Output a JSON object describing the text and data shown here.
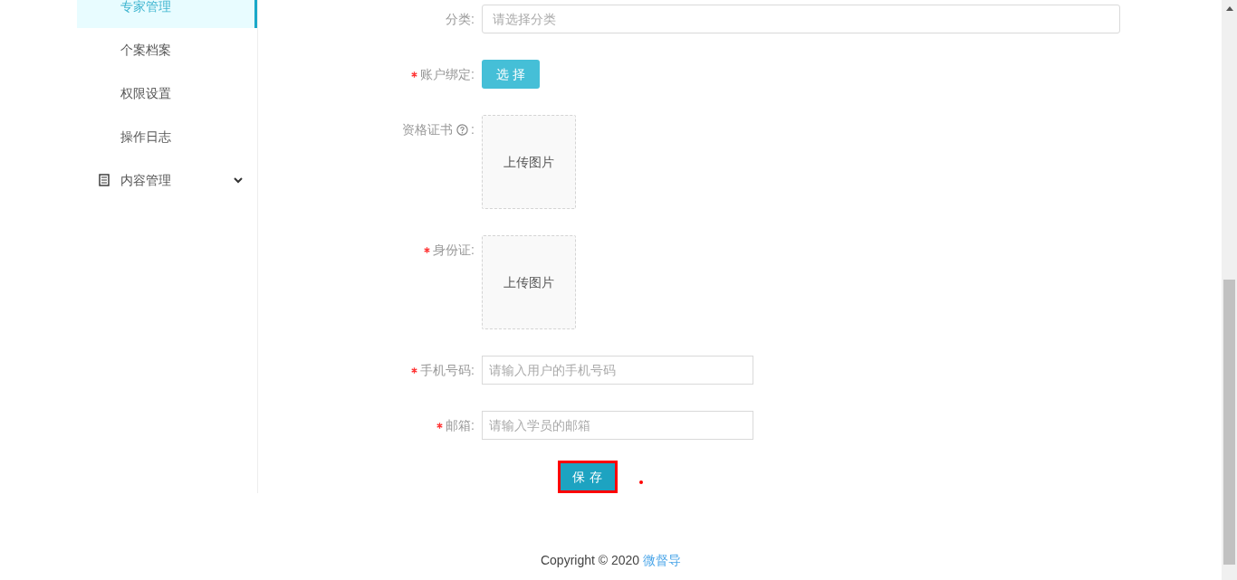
{
  "sidebar": {
    "items": [
      {
        "label": "专家管理",
        "selected": true,
        "kind": "sub"
      },
      {
        "label": "个案档案",
        "selected": false,
        "kind": "sub"
      },
      {
        "label": "权限设置",
        "selected": false,
        "kind": "sub"
      },
      {
        "label": "操作日志",
        "selected": false,
        "kind": "sub"
      },
      {
        "label": "内容管理",
        "selected": false,
        "kind": "group",
        "expanded": false
      }
    ]
  },
  "form": {
    "fields": [
      {
        "kind": "select",
        "label": "分类:",
        "required": false,
        "placeholder": "请选择分类"
      },
      {
        "kind": "button",
        "label": "账户绑定:",
        "required": true,
        "button": "选 择"
      },
      {
        "kind": "upload",
        "label": "资格证书",
        "label_suffix": ":",
        "required": false,
        "help": true,
        "upload": "上传图片"
      },
      {
        "kind": "upload",
        "label": "身份证:",
        "required": true,
        "upload": "上传图片"
      },
      {
        "kind": "input",
        "label": "手机号码:",
        "required": true,
        "placeholder": "请输入用户的手机号码"
      },
      {
        "kind": "input",
        "label": "邮箱:",
        "required": true,
        "placeholder": "请输入学员的邮箱"
      }
    ],
    "save_button": {
      "label": "保 存",
      "highlighted": true
    },
    "marker_dot": true
  },
  "footer": {
    "text": "Copyright © 2020",
    "link": "微督导"
  }
}
